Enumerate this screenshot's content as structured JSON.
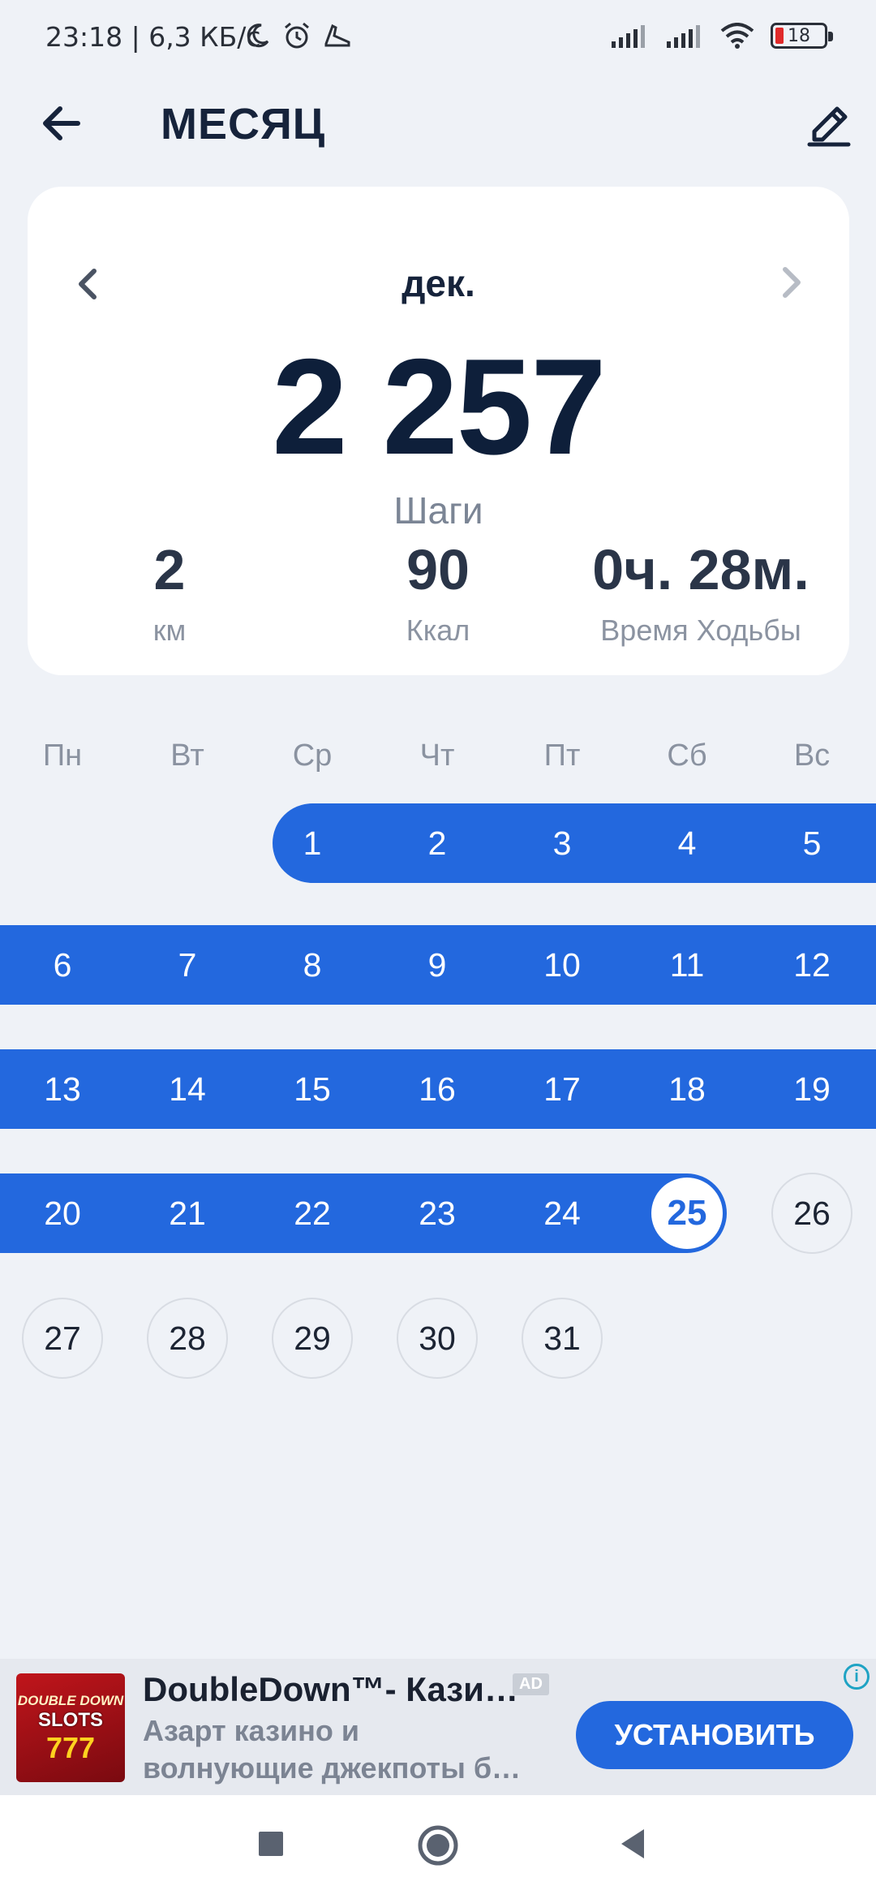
{
  "status_bar": {
    "time": "23:18 | 6,3 КБ/с",
    "battery": "18",
    "icons": [
      "moon-icon",
      "alarm-icon",
      "shoe-icon",
      "signal-icon",
      "signal-icon",
      "wifi-icon",
      "battery-icon"
    ]
  },
  "header": {
    "title": "МЕСЯЦ",
    "back_icon": "arrow-left-icon",
    "edit_icon": "pencil-icon"
  },
  "summary": {
    "month": "дек.",
    "steps_value": "2 257",
    "steps_label": "Шаги",
    "stats": [
      {
        "value": "2",
        "label": "км"
      },
      {
        "value": "90",
        "label": "Ккал"
      },
      {
        "value": "0ч. 28м.",
        "label": "Время Ходьбы"
      }
    ]
  },
  "calendar": {
    "weekdays": [
      "Пн",
      "Вт",
      "Ср",
      "Чт",
      "Пт",
      "Сб",
      "Вс"
    ],
    "week1": [
      "1",
      "2",
      "3",
      "4",
      "5"
    ],
    "week2": [
      "6",
      "7",
      "8",
      "9",
      "10",
      "11",
      "12"
    ],
    "week3": [
      "13",
      "14",
      "15",
      "16",
      "17",
      "18",
      "19"
    ],
    "week4": [
      "20",
      "21",
      "22",
      "23",
      "24"
    ],
    "today": "25",
    "day26": "26",
    "week5": [
      "27",
      "28",
      "29",
      "30",
      "31"
    ]
  },
  "ad": {
    "logo": {
      "line1": "DOUBLE DOWN",
      "line2": "SLOTS",
      "line3": "777"
    },
    "title": "DoubleDown™- Кази…",
    "badge": "AD",
    "description_line1": "Азарт казино и",
    "description_line2": "волнующие джекпоты б…",
    "cta": "УСТАНОВИТЬ",
    "info_icon": "info-icon"
  },
  "colors": {
    "accent": "#2368de",
    "background": "#eff2f7",
    "card": "#ffffff",
    "text_dark": "#0e1f3a"
  }
}
